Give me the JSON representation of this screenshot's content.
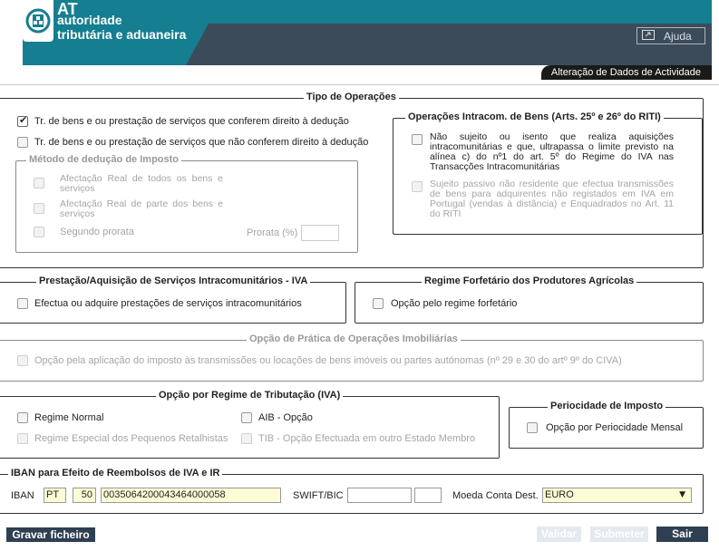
{
  "header": {
    "logo_at": "AT",
    "logo_line1": "autoridade",
    "logo_line2": "tributária e aduaneira",
    "help_label": "Ajuda",
    "section_title": "Alteração de Dados de Actividade"
  },
  "tipo_operacoes": {
    "legend": "Tipo de Operações",
    "opt1": "Tr. de bens e ou prestação de serviços que conferem direito à dedução",
    "opt1_checked": true,
    "opt2": "Tr. de bens e ou prestação de serviços que não conferem direito à dedução",
    "metodo": {
      "legend": "Método de dedução de Imposto",
      "opt1": "Afectação Real de todos os bens e serviços",
      "opt2": "Afectação Real de parte dos bens e serviços",
      "opt3": "Segundo prorata",
      "prorata_label": "Prorata (%)",
      "prorata_value": ""
    },
    "intracom": {
      "legend": "Operações Intracom. de Bens (Arts. 25º e 26º do RITI)",
      "opt1": "Não sujeito ou isento que realiza aquisições intracomunitárias e que, ultrapassa o limite previsto na alínea c) do nº1 do art. 5º do Regime do IVA nas Transacções Intracomunitárias",
      "opt2": "Sujeito passivo não residente que efectua transmissões de bens para adquirentes não registados em IVA em Portugal (vendas à distância) e Enquadrados no Art. 11 do RITI"
    }
  },
  "prestacao": {
    "legend": "Prestação/Aquisição de Serviços Intracomunitários - IVA",
    "opt1": "Efectua ou adquire prestações de serviços intracomunitários"
  },
  "forfetario": {
    "legend": "Regime Forfetário dos Produtores Agrícolas",
    "opt1": "Opção pelo regime forfetário"
  },
  "imobiliarias": {
    "legend": "Opção de Prática de Operações Imobiliárias",
    "opt1": "Opção pela aplicação do imposto às transmissões ou locações de bens imóveis ou partes autónomas (nº 29 e 30 do artº 9º do CIVA)"
  },
  "regime": {
    "legend": "Opção por Regime de Tributação (IVA)",
    "normal": "Regime Normal",
    "aib": "AIB - Opção",
    "retalhistas": "Regime Especial dos Pequenos Retalhistas",
    "tib": "TIB - Opção Efectuada em outro Estado Membro"
  },
  "periodicidade": {
    "legend": "Periocidade de Imposto",
    "opt1": "Opção por Periocidade Mensal"
  },
  "iban": {
    "legend": "IBAN para Efeito de Reembolsos de IVA e IR",
    "label": "IBAN",
    "country": "PT",
    "check": "50",
    "number": "0035064200043464000058",
    "swift_label": "SWIFT/BIC",
    "swift1": "",
    "swift2": "",
    "moeda_label": "Moeda Conta Dest.",
    "moeda_value": "EURO"
  },
  "footer": {
    "gravar": "Gravar ficheiro",
    "validar": "Validar",
    "submeter": "Submeter",
    "sair": "Sair"
  },
  "colors": {
    "header_teal": "#157e90",
    "header_dark": "#3c4b5a",
    "button_dark": "#2e3f52",
    "input_yellow": "#fefcd6"
  }
}
